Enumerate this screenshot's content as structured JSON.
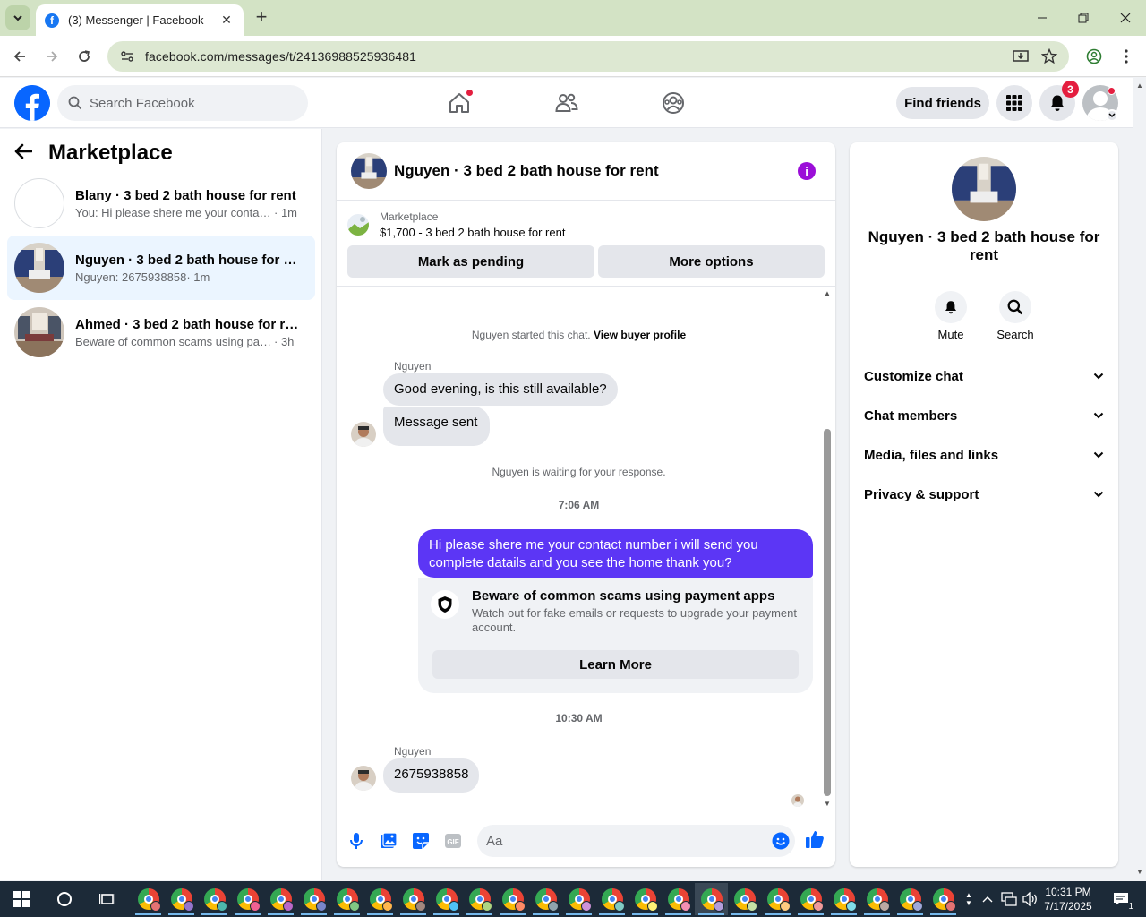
{
  "browser": {
    "tab_title": "(3) Messenger | Facebook",
    "url": "facebook.com/messages/t/24136988525936481"
  },
  "fb": {
    "search_placeholder": "Search Facebook",
    "find_friends": "Find friends",
    "notif_count": "3"
  },
  "sidebar": {
    "title": "Marketplace",
    "conversations": [
      {
        "name": "Blany · 3 bed 2 bath house for rent",
        "snippet": "You: Hi please shere me your contact ...",
        "time": "· 1m"
      },
      {
        "name": "Nguyen · 3 bed 2 bath house for r...",
        "snippet": "Nguyen: 2675938858",
        "time": " · 1m"
      },
      {
        "name": "Ahmed · 3 bed 2 bath house for rent",
        "snippet": "Beware of common scams using pay...",
        "time": " · 3h"
      }
    ]
  },
  "chat": {
    "title": "Nguyen · 3 bed 2 bath house for rent",
    "listing_source": "Marketplace",
    "listing_price": "$1,700 - 3 bed 2 bath house for rent",
    "mark_pending": "Mark as pending",
    "more_options": "More options",
    "started_text": "Nguyen started this chat.",
    "view_buyer": "View buyer profile",
    "sender1": "Nguyen",
    "msg1": "Good evening, is this still available?",
    "msg2": "Message sent",
    "waiting": "Nguyen is waiting for your response.",
    "time1": "7:06 AM",
    "out_line1": "Hi please shere me your contact number i will send you",
    "out_line2": "complete datails and you see the home thank you?",
    "scam_title": "Beware of common scams using payment apps",
    "scam_desc": "Watch out for fake emails or requests to upgrade your payment account.",
    "learn_more": "Learn More",
    "time2": "10:30 AM",
    "sender2": "Nguyen",
    "msg3": "2675938858",
    "composer_placeholder": "Aa"
  },
  "right": {
    "name": "Nguyen · 3 bed 2 bath house for rent",
    "mute": "Mute",
    "search": "Search",
    "sections": [
      "Customize chat",
      "Chat members",
      "Media, files and links",
      "Privacy & support"
    ]
  },
  "taskbar": {
    "time": "10:31 PM",
    "date": "7/17/2025",
    "notif_count": "1"
  },
  "colors": {
    "accent": "#5c36f5",
    "fb_blue": "#0866ff",
    "badge_red": "#e41e3f",
    "info_purple": "#9b0ed8"
  }
}
